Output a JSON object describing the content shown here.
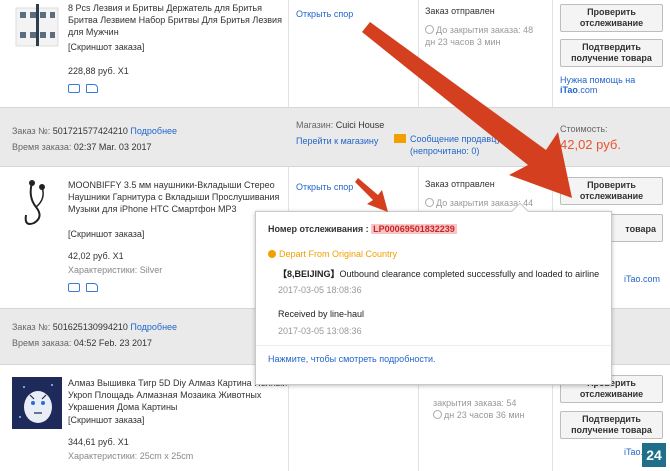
{
  "order1": {
    "title": "8 Pcs Лезвия и Бритвы Держатель для Бритья Бритва Лезвием Набор Бритвы Для Бритья Лезвия для Мужчин",
    "screenshot_label": "[Скриншот заказа]",
    "price": "228,88 руб. X1",
    "dispute_link": "Открыть спор",
    "status": "Заказ отправлен",
    "timer_prefix": "До закрытия заказа: 48",
    "timer_rest": "дн 23 часов 3 мин",
    "btn_track": "Проверить отслеживание",
    "btn_confirm": "Подтвердить получение товара",
    "help_prefix": "Нужна помощь на ",
    "help_brand": "iTao",
    "help_suffix": ".com"
  },
  "order2_head": {
    "order_label": "Заказ №:",
    "order_num": "501721577424210",
    "details_link": "Подробнее",
    "time_label": "Время заказа:",
    "time_value": "02:37 Mar. 03 2017",
    "shop_label": "Магазин:",
    "shop_name": "Cuici House",
    "go_shop": "Перейти к магазину",
    "message_link": "Сообщение продавцу",
    "unread": "(непрочитано: 0)",
    "cost_label": "Стоимость:",
    "cost_value": "42,02 руб."
  },
  "order2": {
    "title": "MOONBIFFY 3.5 мм наушники-Вкладыши Стерео Наушники Гарнитура с Вкладыши Прослушивания Музыки для iPhone HTC Смартфон MP3",
    "screenshot_label": "[Скриншот заказа]",
    "price": "42,02 руб. X1",
    "characteristics": "Характеристики: Silver",
    "dispute_link": "Открыть спор",
    "status": "Заказ отправлен",
    "timer_prefix": "До закрытия заказа: 44",
    "btn_track": "Проверить отслеживание",
    "btn_confirm_tail": "товара",
    "itao_tail": "iTao.com"
  },
  "order3_head": {
    "order_label": "Заказ №:",
    "order_num": "501625130994210",
    "details_link": "Подробнее",
    "time_label": "Время заказа:",
    "time_value": "04:52 Feb. 23 2017"
  },
  "order3": {
    "title": "Алмаз Вышивка Тигр 5D Diy Алмаз Картина Полный Укроп Площадь Алмазная Мозаика Животных Украшения Дома Картины",
    "screenshot_label": "[Скриншот заказа]",
    "price": "344,61 руб. X1",
    "characteristics": "Характеристики: 25cm x 25cm",
    "timer_top": "закрытия заказа: 54",
    "timer_rest": "дн 23 часов 36 мин",
    "btn_track": "Проверить отслеживание",
    "btn_confirm": "Подтвердить получение товара",
    "itao_tail": "iTao.com"
  },
  "popup": {
    "track_label": "Номер отслеживания :",
    "track_number": "LP00069501832239",
    "status_title": "Depart From Original Country",
    "event1_tag": "【8,BEIJING】",
    "event1_text": "Outbound clearance completed successfully and loaded to airline",
    "event1_time": "2017-03-05 18:08:36",
    "event2_text": "Received by line-haul",
    "event2_time": "2017-03-05 13:08:36",
    "details_link": "Нажмите, чтобы смотреть подробности."
  },
  "badge": "24",
  "colors": {
    "accent_red": "#d33f1f",
    "link": "#2266cc",
    "cost_red": "#e8542f"
  }
}
